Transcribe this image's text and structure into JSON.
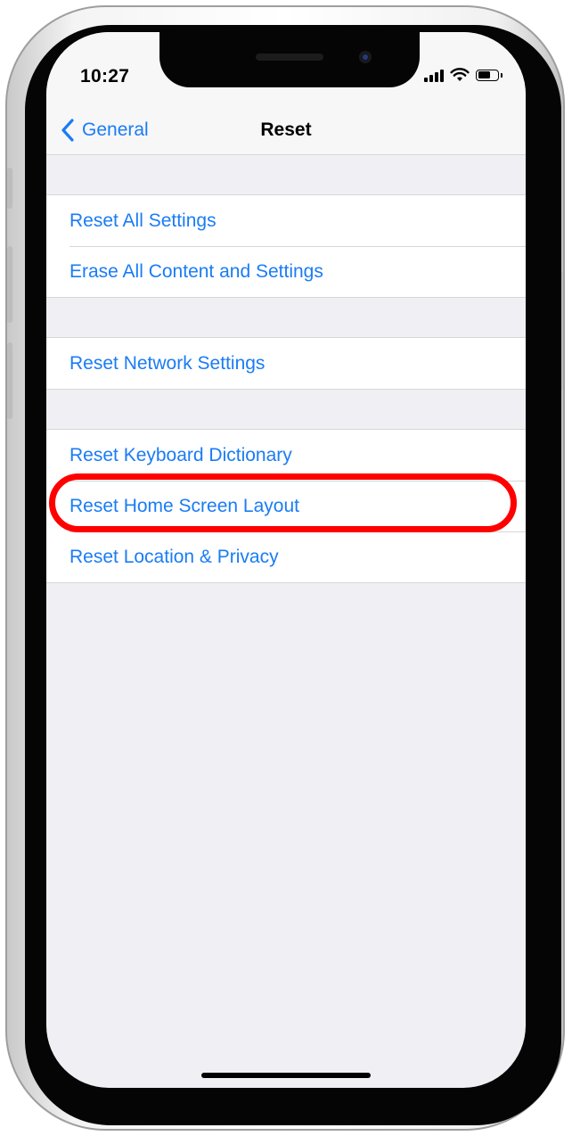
{
  "status_bar": {
    "time": "10:27",
    "icons": [
      "cellular-signal-icon",
      "wifi-icon",
      "battery-icon"
    ],
    "battery_level": 0.7
  },
  "nav": {
    "back_label": "General",
    "back_icon": "chevron-left-icon",
    "title": "Reset"
  },
  "groups": [
    {
      "items": [
        {
          "label": "Reset All Settings"
        },
        {
          "label": "Erase All Content and Settings"
        }
      ]
    },
    {
      "items": [
        {
          "label": "Reset Network Settings"
        }
      ]
    },
    {
      "items": [
        {
          "label": "Reset Keyboard Dictionary"
        },
        {
          "label": "Reset Home Screen Layout",
          "highlighted": true
        },
        {
          "label": "Reset Location & Privacy"
        }
      ]
    }
  ],
  "colors": {
    "link_blue": "#1a7cf5",
    "background_gray": "#efeff4",
    "highlight_red": "#ff0000"
  }
}
